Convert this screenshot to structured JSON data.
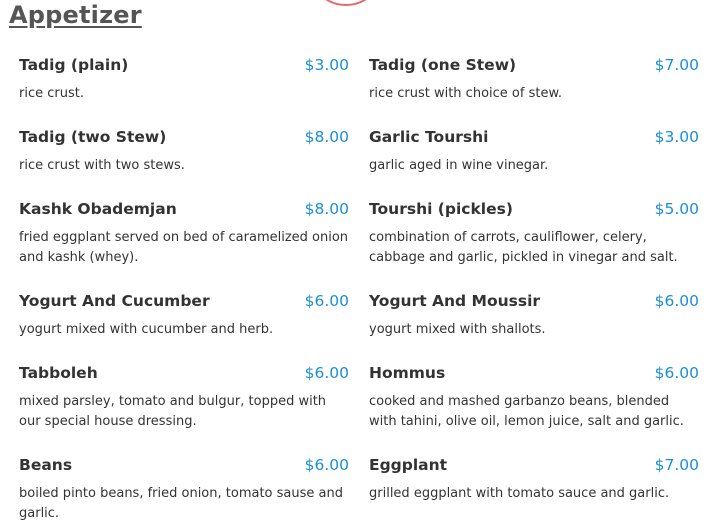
{
  "section": {
    "title": "Appetizer"
  },
  "colors": {
    "price": "#1a8fd6",
    "logo": "#e56a6a"
  },
  "items": [
    {
      "name": "Tadig (plain)",
      "price": "$3.00",
      "desc": "rice crust."
    },
    {
      "name": "Tadig (one Stew)",
      "price": "$7.00",
      "desc": "rice crust with choice of stew."
    },
    {
      "name": "Tadig (two Stew)",
      "price": "$8.00",
      "desc": "rice crust with two stews."
    },
    {
      "name": "Garlic Tourshi",
      "price": "$3.00",
      "desc": "garlic aged in wine vinegar."
    },
    {
      "name": "Kashk Obademjan",
      "price": "$8.00",
      "desc": "fried eggplant served on bed of caramelized onion and kashk (whey)."
    },
    {
      "name": "Tourshi (pickles)",
      "price": "$5.00",
      "desc": "combination of carrots, cauliflower, celery, cabbage and garlic, pickled in vinegar and salt."
    },
    {
      "name": "Yogurt And Cucumber",
      "price": "$6.00",
      "desc": "yogurt mixed with cucumber and herb."
    },
    {
      "name": "Yogurt And Moussir",
      "price": "$6.00",
      "desc": "yogurt mixed with shallots."
    },
    {
      "name": "Tabboleh",
      "price": "$6.00",
      "desc": "mixed parsley, tomato and bulgur, topped with our special house dressing."
    },
    {
      "name": "Hommus",
      "price": "$6.00",
      "desc": "cooked and mashed garbanzo beans, blended with tahini, olive oil, lemon juice, salt and garlic."
    },
    {
      "name": "Beans",
      "price": "$6.00",
      "desc": "boiled pinto beans, fried onion, tomato sause and garlic."
    },
    {
      "name": "Eggplant",
      "price": "$7.00",
      "desc": "grilled eggplant with tomato sauce and garlic."
    }
  ]
}
